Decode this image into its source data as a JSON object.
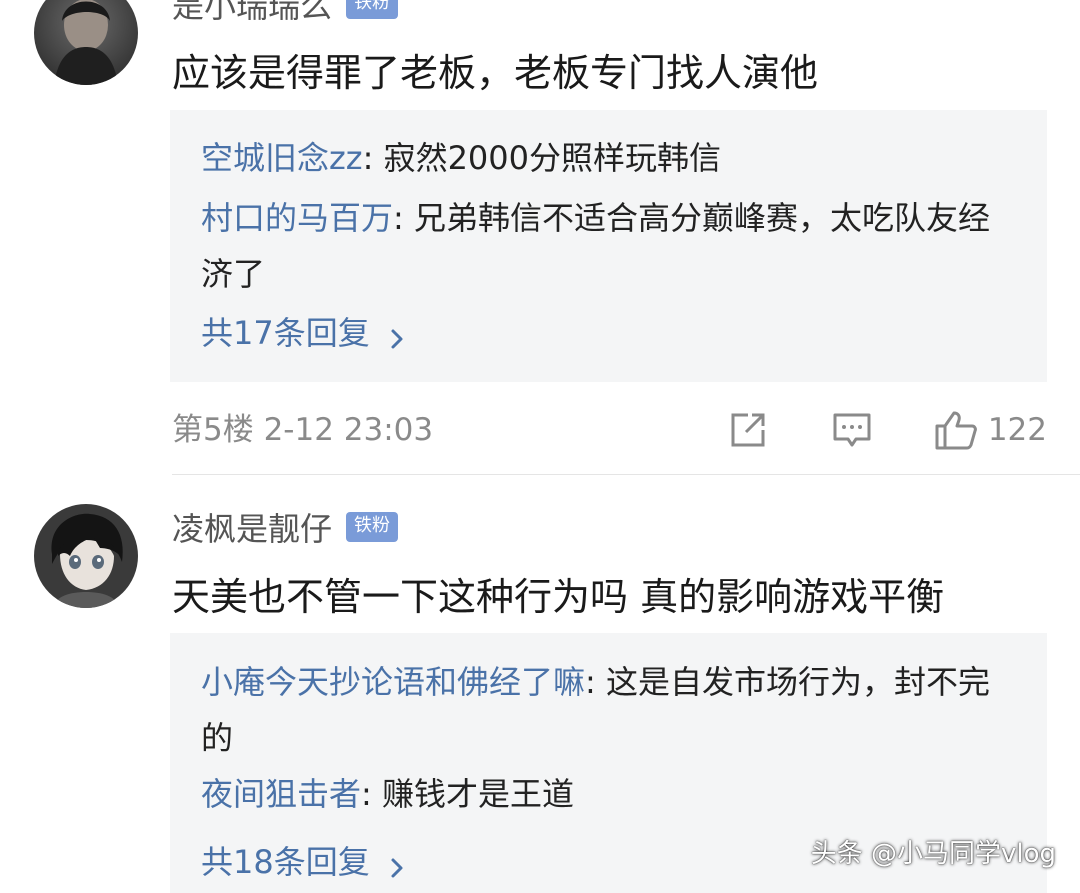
{
  "comments": [
    {
      "username": "是小瑞瑞么",
      "badge": "铁粉",
      "text": "应该是得罪了老板，老板专门找人演他",
      "replies": [
        {
          "user": "空城旧念zz",
          "sep": ": ",
          "text": "寂然2000分照样玩韩信"
        },
        {
          "user": "村口的马百万",
          "sep": ": ",
          "text": "兄弟韩信不适合高分巅峰赛，太吃队友经济了"
        }
      ],
      "more_replies": "共17条回复",
      "floor_time": "第5楼 2-12 23:03",
      "likes": "122"
    },
    {
      "username": "凌枫是靓仔",
      "badge": "铁粉",
      "text": "天美也不管一下这种行为吗 真的影响游戏平衡",
      "replies": [
        {
          "user": "小庵今天抄论语和佛经了嘛",
          "sep": ": ",
          "text": "这是自发市场行为，封不完的"
        },
        {
          "user": "夜间狙击者",
          "sep": ": ",
          "text": "赚钱才是王道"
        }
      ],
      "more_replies": "共18条回复"
    }
  ],
  "watermark": "头条 @小马同学vlog",
  "colors": {
    "reply_user": "#4a72a8",
    "badge_bg": "#7a9bd8",
    "reply_box_bg": "#f4f5f6",
    "meta_text": "#8a8a8a"
  },
  "icons": {
    "share": "share-icon",
    "comment": "comment-icon",
    "like": "thumbs-up-icon",
    "chevron": "chevron-right-icon"
  }
}
